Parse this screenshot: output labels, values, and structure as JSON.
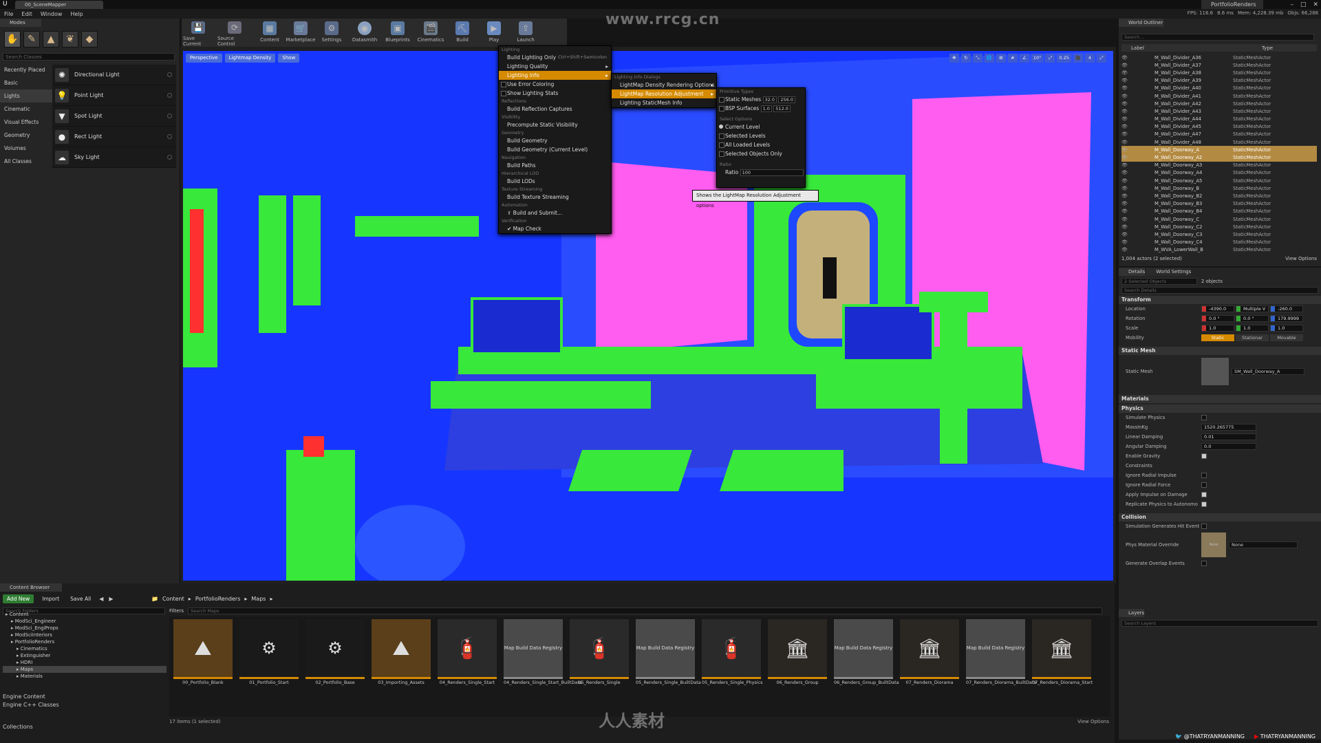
{
  "titlebar": {
    "doc_tab": "00_SceneMapper",
    "project": "PortfolioRenders"
  },
  "menu": [
    "File",
    "Edit",
    "Window",
    "Help"
  ],
  "stats": {
    "fps": "FPS: 116.6",
    "ms": "8.6 ms",
    "mem": "Mem: 4,228.39 mb",
    "objs": "Objs: 66,288"
  },
  "watermark": "www.rrcg.cn",
  "watermark2": "人人素材",
  "modes": {
    "tab": "Modes",
    "search_placeholder": "Search Classes",
    "categories": [
      "Recently Placed",
      "Basic",
      "Lights",
      "Cinematic",
      "Visual Effects",
      "Geometry",
      "Volumes",
      "All Classes"
    ],
    "lights": [
      "Directional Light",
      "Point Light",
      "Spot Light",
      "Rect Light",
      "Sky Light"
    ]
  },
  "toolbar": [
    "Save Current",
    "Source Control",
    "Content",
    "Marketplace",
    "Settings",
    "Datasmith",
    "Blueprints",
    "Cinematics",
    "Build",
    "Play",
    "Launch"
  ],
  "viewport": {
    "perspective": "Perspective",
    "view_mode": "Lightmap Density",
    "show": "Show",
    "tools": [
      "10°",
      "0.25",
      "4"
    ]
  },
  "build_menu": {
    "sections": [
      {
        "title": "Lighting",
        "items": [
          {
            "label": "Build Lighting Only",
            "shortcut": "Ctrl+Shift+Semicolon"
          },
          {
            "label": "Lighting Quality",
            "submenu": true
          },
          {
            "label": "Lighting Info",
            "submenu": true,
            "highlight": true
          },
          {
            "label": "Use Error Coloring",
            "check": true
          },
          {
            "label": "Show Lighting Stats",
            "check": true
          }
        ]
      },
      {
        "title": "Reflections",
        "items": [
          {
            "label": "Build Reflection Captures"
          }
        ]
      },
      {
        "title": "Visibility",
        "items": [
          {
            "label": "Precompute Static Visibility"
          }
        ]
      },
      {
        "title": "Geometry",
        "items": [
          {
            "label": "Build Geometry"
          },
          {
            "label": "Build Geometry (Current Level)"
          }
        ]
      },
      {
        "title": "Navigation",
        "items": [
          {
            "label": "Build Paths"
          }
        ]
      },
      {
        "title": "Hierarchical LOD",
        "items": [
          {
            "label": "Build LODs"
          }
        ]
      },
      {
        "title": "Texture Streaming",
        "items": [
          {
            "label": "Build Texture Streaming"
          }
        ]
      },
      {
        "title": "Automation",
        "items": [
          {
            "label": "Build and Submit..."
          }
        ]
      },
      {
        "title": "Verification",
        "items": [
          {
            "label": "Map Check"
          }
        ]
      }
    ]
  },
  "lighting_info_menu": {
    "section": "Lighting Info Dialogs",
    "items": [
      "LightMap Density Rendering Options",
      "LightMap Resolution Adjustment",
      "Lighting StaticMesh Info"
    ]
  },
  "adjust_menu": {
    "primitive_types": "Primitive Types",
    "static_meshes": "Static Meshes",
    "sm_min": "32.0",
    "sm_max": "256.0",
    "bsp_surfaces": "BSP Surfaces",
    "bsp_min": "1.0",
    "bsp_max": "512.0",
    "select_options": "Select Options",
    "options": [
      "Current Level",
      "Selected Levels",
      "All Loaded Levels",
      "Selected Objects Only"
    ],
    "ratio_section": "Ratio",
    "ratio_label": "Ratio",
    "ratio_value": "100"
  },
  "tooltip": "Shows the LightMap Resolution Adjustment options",
  "outliner": {
    "tab": "World Outliner",
    "search_placeholder": "Search...",
    "col_label": "Label",
    "col_type": "Type",
    "rows": [
      {
        "name": "M_Wall_Divider_A36",
        "type": "StaticMeshActor"
      },
      {
        "name": "M_Wall_Divider_A37",
        "type": "StaticMeshActor"
      },
      {
        "name": "M_Wall_Divider_A38",
        "type": "StaticMeshActor"
      },
      {
        "name": "M_Wall_Divider_A39",
        "type": "StaticMeshActor"
      },
      {
        "name": "M_Wall_Divider_A40",
        "type": "StaticMeshActor"
      },
      {
        "name": "M_Wall_Divider_A41",
        "type": "StaticMeshActor"
      },
      {
        "name": "M_Wall_Divider_A42",
        "type": "StaticMeshActor"
      },
      {
        "name": "M_Wall_Divider_A43",
        "type": "StaticMeshActor"
      },
      {
        "name": "M_Wall_Divider_A44",
        "type": "StaticMeshActor"
      },
      {
        "name": "M_Wall_Divider_A45",
        "type": "StaticMeshActor"
      },
      {
        "name": "M_Wall_Divider_A47",
        "type": "StaticMeshActor"
      },
      {
        "name": "M_Wall_Divider_A48",
        "type": "StaticMeshActor"
      },
      {
        "name": "M_Wall_Doorway_A",
        "type": "StaticMeshActor",
        "sel": true
      },
      {
        "name": "M_Wall_Doorway_A2",
        "type": "StaticMeshActor",
        "sel": true
      },
      {
        "name": "M_Wall_Doorway_A3",
        "type": "StaticMeshActor"
      },
      {
        "name": "M_Wall_Doorway_A4",
        "type": "StaticMeshActor"
      },
      {
        "name": "M_Wall_Doorway_A5",
        "type": "StaticMeshActor"
      },
      {
        "name": "M_Wall_Doorway_B",
        "type": "StaticMeshActor"
      },
      {
        "name": "M_Wall_Doorway_B2",
        "type": "StaticMeshActor"
      },
      {
        "name": "M_Wall_Doorway_B3",
        "type": "StaticMeshActor"
      },
      {
        "name": "M_Wall_Doorway_B4",
        "type": "StaticMeshActor"
      },
      {
        "name": "M_Wall_Doorway_C",
        "type": "StaticMeshActor"
      },
      {
        "name": "M_Wall_Doorway_C2",
        "type": "StaticMeshActor"
      },
      {
        "name": "M_Wall_Doorway_C3",
        "type": "StaticMeshActor"
      },
      {
        "name": "M_Wall_Doorway_C4",
        "type": "StaticMeshActor"
      },
      {
        "name": "M_WVA_LowerWall_B",
        "type": "StaticMeshActor"
      }
    ],
    "footer": "1,004 actors (2 selected)",
    "view_options": "View Options"
  },
  "details": {
    "tab": "Details",
    "tab2": "World Settings",
    "selected": "2 Selected Objects",
    "objects": "2 objects",
    "search_placeholder": "Search Details",
    "transform": "Transform",
    "location": "Location",
    "loc": [
      "-4390.0",
      "Multiple V",
      "-260.0"
    ],
    "rotation": "Rotation",
    "rot": [
      "0.0 °",
      "0.0 °",
      "179.9999"
    ],
    "scale": "Scale",
    "scl": [
      "1.0",
      "1.0",
      "1.0"
    ],
    "mobility": "Mobility",
    "mob": [
      "Static",
      "Stationar",
      "Movable"
    ],
    "static_mesh_sec": "Static Mesh",
    "static_mesh": "Static Mesh",
    "mesh_name": "SM_Wall_Doorway_A",
    "materials": "Materials",
    "physics": "Physics",
    "physics_rows": [
      {
        "label": "Simulate Physics",
        "type": "check",
        "on": false
      },
      {
        "label": "MassInKg",
        "type": "text",
        "value": "1520.265775"
      },
      {
        "label": "Linear Damping",
        "type": "text",
        "value": "0.01"
      },
      {
        "label": "Angular Damping",
        "type": "text",
        "value": "0.0"
      },
      {
        "label": "Enable Gravity",
        "type": "check",
        "on": true
      },
      {
        "label": "Constraints",
        "type": "none"
      },
      {
        "label": "Ignore Radial Impulse",
        "type": "check",
        "on": false
      },
      {
        "label": "Ignore Radial Force",
        "type": "check",
        "on": false
      },
      {
        "label": "Apply Impulse on Damage",
        "type": "check",
        "on": true
      },
      {
        "label": "Replicate Physics to Autonomo",
        "type": "check",
        "on": true
      }
    ],
    "collision": "Collision",
    "sim_gen_hit": "Simulation Generates Hit Event",
    "phys_mat": "Phys Material Override",
    "phys_none": "None",
    "phys_thumb": "None",
    "gen_overlap": "Generate Overlap Events"
  },
  "layers": {
    "tab": "Layers",
    "search_placeholder": "Search Layers"
  },
  "content_browser": {
    "tab": "Content Browser",
    "add_new": "Add New",
    "import": "Import",
    "save_all": "Save All",
    "crumbs": [
      "Content",
      "PortfolioRenders",
      "Maps"
    ],
    "search_folders": "Search Folders",
    "filters": "Filters",
    "search_maps": "Search Maps",
    "tree": [
      {
        "label": "Content",
        "indent": 0
      },
      {
        "label": "ModSci_Engineer",
        "indent": 1
      },
      {
        "label": "ModSci_EngiProps",
        "indent": 1
      },
      {
        "label": "ModSciInteriors",
        "indent": 1
      },
      {
        "label": "PortfolioRenders",
        "indent": 1
      },
      {
        "label": "Cinematics",
        "indent": 2
      },
      {
        "label": "Extinguisher",
        "indent": 2
      },
      {
        "label": "HDRI",
        "indent": 2
      },
      {
        "label": "Maps",
        "indent": 2,
        "sel": true
      },
      {
        "label": "Materials",
        "indent": 2
      }
    ],
    "engine_content": "Engine Content",
    "engine_cpp": "Engine C++ Classes",
    "assets": [
      {
        "name": "00_Portfolio_Blank",
        "kind": "map",
        "bar": "#d58a00"
      },
      {
        "name": "01_Portfolio_Start",
        "kind": "dark",
        "bar": "#d58a00"
      },
      {
        "name": "02_Portfolio_Base",
        "kind": "dark",
        "bar": "#d58a00"
      },
      {
        "name": "03_Importing_Assets",
        "kind": "map",
        "bar": "#d58a00"
      },
      {
        "name": "04_Renders_Single_Start",
        "kind": "red",
        "bar": "#d58a00"
      },
      {
        "name": "04_Renders_Single_Start_BuiltData",
        "kind": "registry",
        "bar": "#8a8a8a",
        "label": "Map Build Data Registry"
      },
      {
        "name": "05_Renders_Single",
        "kind": "red",
        "bar": "#d58a00"
      },
      {
        "name": "05_Renders_Single_BuiltData",
        "kind": "registry",
        "bar": "#8a8a8a",
        "label": "Map Build Data Registry"
      },
      {
        "name": "05_Renders_Single_Physics",
        "kind": "red",
        "bar": "#d58a00"
      },
      {
        "name": "06_Renders_Group",
        "kind": "group",
        "bar": "#d58a00"
      },
      {
        "name": "06_Renders_Group_BuiltData",
        "kind": "registry",
        "bar": "#8a8a8a",
        "label": "Map Build Data Registry"
      },
      {
        "name": "07_Renders_Diorama",
        "kind": "group",
        "bar": "#d58a00"
      },
      {
        "name": "07_Renders_Diorama_BuiltData",
        "kind": "registry",
        "bar": "#8a8a8a",
        "label": "Map Build Data Registry"
      },
      {
        "name": "07_Renders_Diorama_Start",
        "kind": "group",
        "bar": "#d58a00"
      }
    ],
    "footer": "17 items (1 selected)",
    "view_options": "View Options",
    "collections": "Collections"
  },
  "social": [
    "@THATRYANMANNING",
    "THATRYANMANNING"
  ]
}
